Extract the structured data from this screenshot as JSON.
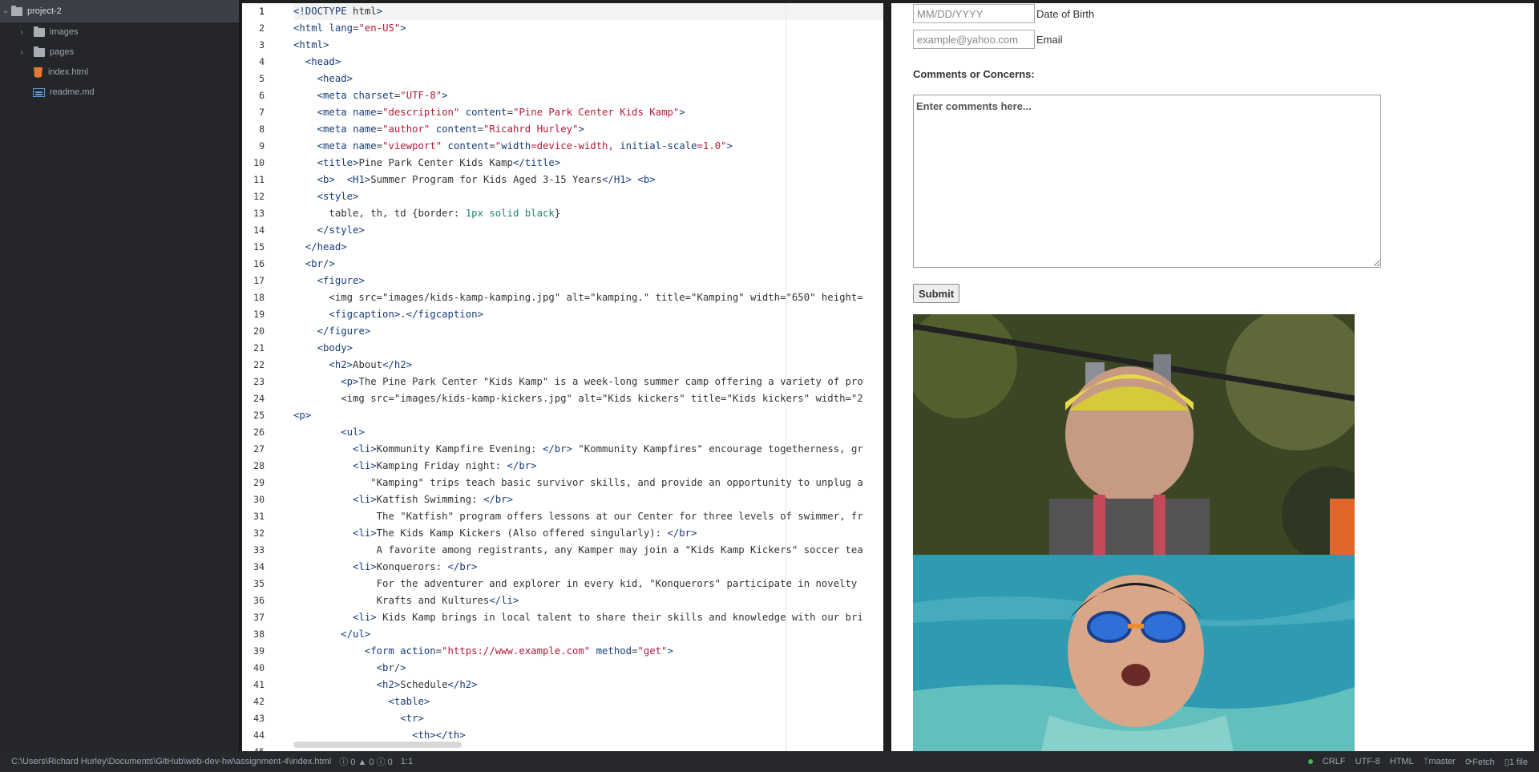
{
  "tree": {
    "root": "project-2",
    "items": [
      {
        "label": "images",
        "kind": "folder"
      },
      {
        "label": "pages",
        "kind": "folder"
      },
      {
        "label": "index.html",
        "kind": "html"
      },
      {
        "label": "readme.md",
        "kind": "md"
      }
    ]
  },
  "editor": {
    "current_line": 1,
    "line_numbers": [
      "1",
      "2",
      "3",
      "4",
      "5",
      "6",
      "7",
      "8",
      "9",
      "10",
      "11",
      "12",
      "13",
      "14",
      "15",
      "16",
      "17",
      "18",
      "19",
      "20",
      "21",
      "22",
      "23",
      "24",
      "25",
      "26",
      "27",
      "28",
      "29",
      "30",
      "31",
      "32",
      "33",
      "34",
      "35",
      "36",
      "37",
      "38",
      "39",
      "40",
      "41",
      "42",
      "43",
      "44",
      "45"
    ],
    "lines": [
      "<!DOCTYPE html>",
      "<html lang=\"en-US\">",
      "<html>",
      "  <head>",
      "    <head>",
      "    <meta charset=\"UTF-8\">",
      "    <meta name=\"description\" content=\"Pine Park Center Kids Kamp\">",
      "    <meta name=\"author\" content=\"Ricahrd Hurley\">",
      "    <meta name=\"viewport\" content=\"width=device-width, initial-scale=1.0\">",
      "    <title>Pine Park Center Kids Kamp</title>",
      "    <b>  <H1>Summer Program for Kids Aged 3-15 Years</H1> <b>",
      "    <style>",
      "      table, th, td {border: 1px solid black}",
      "    </style>",
      "  </head>",
      "  <br/>",
      "    <figure>",
      "      <img src=\"images/kids-kamp-kamping.jpg\" alt=\"kamping.\" title=\"Kamping\" width=\"650\" height=",
      "      <figcaption>.</figcaption>",
      "    </figure>",
      "    <body>",
      "      <h2>About</h2>",
      "        <p>The Pine Park Center \"Kids Kamp\" is a week-long summer camp offering a variety of pro",
      "        <img src=\"images/kids-kamp-kickers.jpg\" alt=\"Kids kickers\" title=\"Kids kickers\" width=\"2",
      "<p>",
      "        <ul>",
      "          <li>Kommunity Kampfire Evening: </br> \"Kommunity Kampfires\" encourage togetherness, gr",
      "          <li>Kamping Friday night: </br>",
      "             \"Kamping\" trips teach basic survivor skills, and provide an opportunity to unplug a",
      "          <li>Katfish Swimming: </br>",
      "              The \"Katfish\" program offers lessons at our Center for three levels of swimmer, fr",
      "          <li>The Kids Kamp Kickers (Also offered singularly): </br>",
      "              A favorite among registrants, any Kamper may join a \"Kids Kamp Kickers\" soccer tea",
      "          <li>Konquerors: </br>",
      "              For the adventurer and explorer in every kid, \"Konquerors\" participate in novelty",
      "              Krafts and Kultures</li>",
      "          <li> Kids Kamp brings in local talent to share their skills and knowledge with our bri",
      "        </ul>",
      "            <form action=\"https://www.example.com\" method=\"get\">",
      "              <br/>",
      "              <h2>Schedule</h2>",
      "                <table>",
      "                  <tr>",
      "                    <th></th>",
      ""
    ]
  },
  "preview": {
    "dob_placeholder": "MM/DD/YYYY",
    "dob_label": "Date of Birth",
    "email_placeholder": "example@yahoo.com",
    "email_label": "Email",
    "comments_label": "Comments or Concerns:",
    "comments_placeholder": "Enter comments here...",
    "submit_label": "Submit",
    "photo1_alt": "kid on zipline",
    "photo2_alt": "kid swimming"
  },
  "status": {
    "path": "C:\\Users\\Richard Hurley\\Documents\\GitHub\\web-dev-hw\\assignment-4\\index.html",
    "errors": "0",
    "warnings": "0",
    "infos": "0",
    "cursor": "1:1",
    "line_ending": "CRLF",
    "encoding": "UTF-8",
    "grammar": "HTML",
    "branch": "master",
    "fetch": "Fetch",
    "files": "1 file"
  }
}
